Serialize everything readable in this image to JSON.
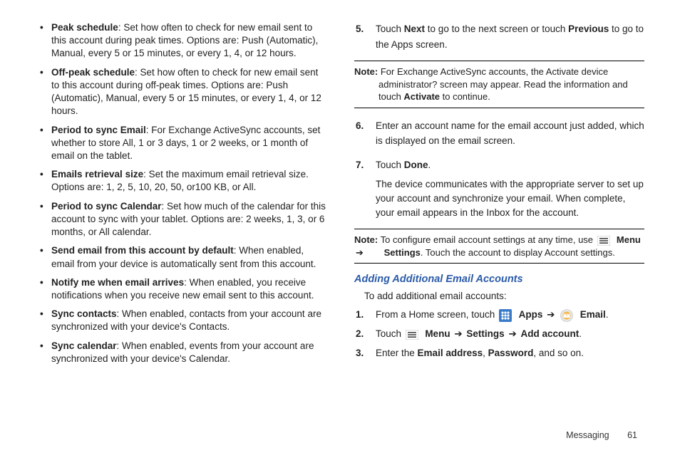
{
  "left": {
    "bullets": [
      {
        "term": "Peak schedule",
        "desc": ": Set how often to check for new email sent to this account during peak times. Options are: Push (Automatic), Manual, every 5 or 15 minutes, or every 1, 4, or 12 hours."
      },
      {
        "term": "Off-peak schedule",
        "desc": ": Set how often to check for new email sent to this account during off-peak times. Options are: Push (Automatic), Manual, every 5 or 15 minutes, or every 1, 4, or 12 hours."
      },
      {
        "term": "Period to sync Email",
        "desc": ": For Exchange ActiveSync accounts, set whether to store All, 1 or 3 days, 1 or 2 weeks, or 1 month of email on the tablet."
      },
      {
        "term": "Emails retrieval size",
        "desc": ": Set the maximum email retrieval size. Options are: 1, 2, 5, 10, 20, 50, or100 KB, or All."
      },
      {
        "term": "Period to sync Calendar",
        "desc": ": Set how much of the calendar for this account to sync with your tablet. Options are: 2 weeks, 1, 3, or 6 months, or All calendar."
      },
      {
        "term": "Send email from this account by default",
        "desc": ": When enabled, email from your device is automatically sent from this account."
      },
      {
        "term": "Notify me when email arrives",
        "desc": ": When enabled, you receive notifications when you receive new email sent to this account."
      },
      {
        "term": "Sync contacts",
        "desc": ": When enabled, contacts from your account are synchronized with your device's Contacts."
      },
      {
        "term": "Sync calendar",
        "desc": ": When enabled, events from your account are synchronized with your device's Calendar."
      }
    ]
  },
  "right": {
    "step5": {
      "num": "5.",
      "pre": "Touch ",
      "next": "Next",
      "mid": " to go to the next screen or touch ",
      "prev": "Previous",
      "post": " to go to the Apps screen."
    },
    "note1": {
      "label": "Note:",
      "body_pre": " For Exchange ActiveSync accounts, the Activate device administrator? screen may appear. Read the information and touch ",
      "activate": "Activate",
      "body_post": " to continue."
    },
    "step6": {
      "num": "6.",
      "body": "Enter an account name for the email account just added, which is displayed on the email screen."
    },
    "step7": {
      "num": "7.",
      "pre": "Touch ",
      "done": "Done",
      "post": ".",
      "note": "The device communicates with the appropriate server to set up your account and synchronize your email. When complete, your email appears in the Inbox for the account."
    },
    "note2": {
      "label": "Note:",
      "pre": " To configure email account settings at any time, use ",
      "menu": "Menu",
      "arrow": "➔",
      "settings": "Settings",
      "post": ". Touch the account to display Account settings."
    },
    "subhead": "Adding Additional Email Accounts",
    "intro": "To add additional email accounts:",
    "add1": {
      "num": "1.",
      "pre": "From a Home screen, touch ",
      "apps": "Apps",
      "arrow": "➔",
      "email": "Email",
      "post": "."
    },
    "add2": {
      "num": "2.",
      "pre": "Touch ",
      "menu": "Menu",
      "arrow": "➔",
      "settings": "Settings",
      "addacct": "Add account",
      "post": "."
    },
    "add3": {
      "num": "3.",
      "pre": "Enter the ",
      "ea": "Email address",
      "comma": ", ",
      "pw": "Password",
      "post": ", and so on."
    }
  },
  "footer": {
    "section": "Messaging",
    "page": "61"
  }
}
